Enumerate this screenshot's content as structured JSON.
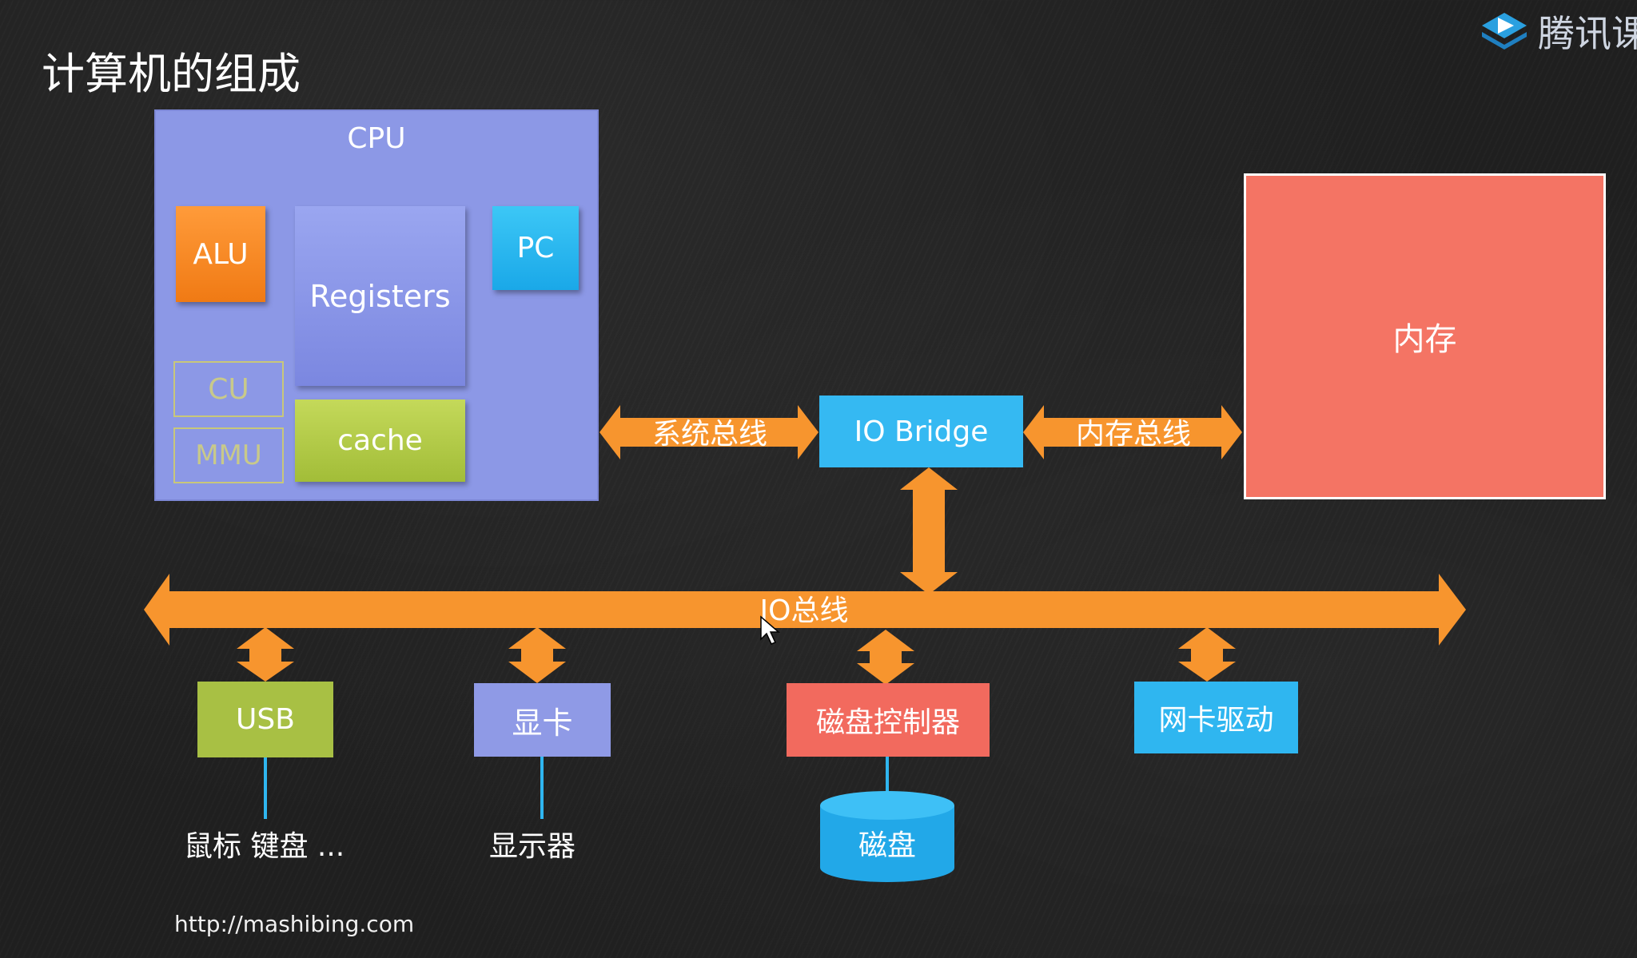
{
  "page": {
    "title": "计算机的组成",
    "watermark": "腾讯课",
    "url": "http://mashibing.com"
  },
  "cpu": {
    "label": "CPU",
    "alu": "ALU",
    "registers": "Registers",
    "pc": "PC",
    "cu": "CU",
    "mmu": "MMU",
    "cache": "cache"
  },
  "buses": {
    "system": "系统总线",
    "memory": "内存总线",
    "io": "IO总线"
  },
  "io_bridge": "IO Bridge",
  "memory": "内存",
  "devices": {
    "usb": "USB",
    "gpu": "显卡",
    "disk_controller": "磁盘控制器",
    "nic": "网卡驱动"
  },
  "peripherals": {
    "mouse_keyboard": "鼠标 键盘 ...",
    "display": "显示器",
    "disk": "磁盘"
  },
  "colors": {
    "arrow": "#f7952e",
    "cpu": "#8c98e6",
    "memory": "#f47464",
    "io_bridge": "#35b9f2",
    "connector": "#2fb6f0"
  }
}
